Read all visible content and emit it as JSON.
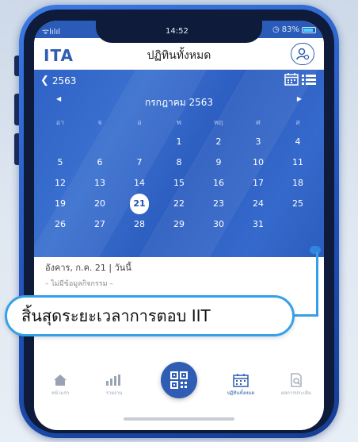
{
  "status": {
    "carrier": "ᯤlılıl",
    "time": "14:52",
    "battery": "83%"
  },
  "header": {
    "logo": "ITA",
    "title": "ปฏิทินทั้งหมด"
  },
  "calendar": {
    "year": "2563",
    "month": "กรกฎาคม 2563",
    "weekdays": [
      "อา",
      "จ",
      "อ",
      "พ",
      "พฤ",
      "ศ",
      "ส"
    ],
    "weeks": [
      [
        "",
        "",
        "",
        "1",
        "2",
        "3",
        "4"
      ],
      [
        "5",
        "6",
        "7",
        "8",
        "9",
        "10",
        "11"
      ],
      [
        "12",
        "13",
        "14",
        "15",
        "16",
        "17",
        "18"
      ],
      [
        "19",
        "20",
        "21",
        "22",
        "23",
        "24",
        "25"
      ],
      [
        "26",
        "27",
        "28",
        "29",
        "30",
        "31",
        ""
      ]
    ],
    "today": "21"
  },
  "date_info": {
    "label": "อังคาร, ก.ค. 21 | วันนี้",
    "empty": "– ไม่มีข้อมูลกิจกรรม –"
  },
  "callout": {
    "text": "สิ้นสุดระยะเวลาการตอบ IIT"
  },
  "tabs": [
    {
      "label": "หน้าแรก",
      "icon": "home-icon"
    },
    {
      "label": "รายงาน",
      "icon": "chart-icon"
    },
    {
      "label": "ปฏิทินทั้งหมด",
      "icon": "calendar-icon"
    },
    {
      "label": "ผลการประเมิน",
      "icon": "document-search-icon"
    }
  ],
  "colors": {
    "accent": "#2f5db3",
    "callout_border": "#35a0e8"
  }
}
